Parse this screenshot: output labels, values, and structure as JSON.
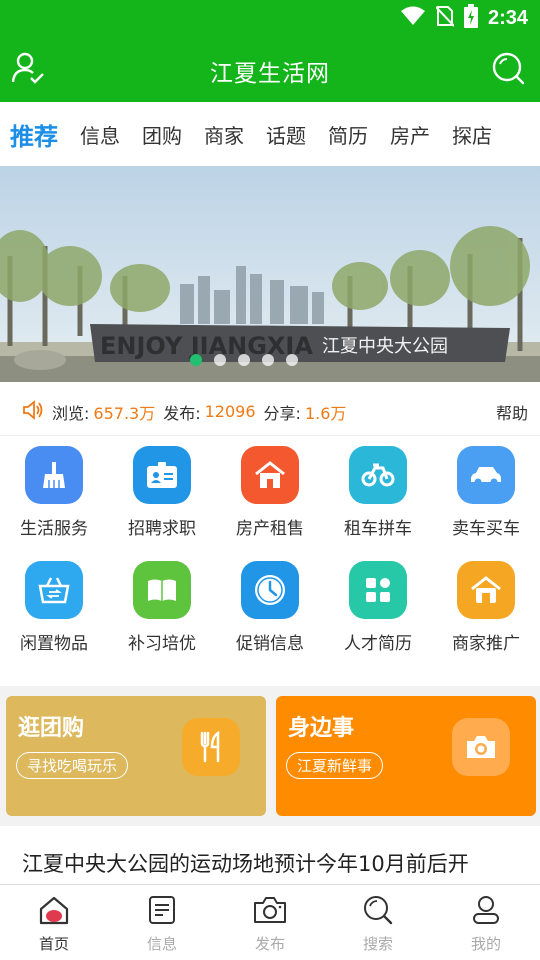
{
  "status_bar": {
    "time": "2:34"
  },
  "header": {
    "title": "江夏生活网"
  },
  "tabs": [
    {
      "label": "推荐"
    },
    {
      "label": "信息"
    },
    {
      "label": "团购"
    },
    {
      "label": "商家"
    },
    {
      "label": "话题"
    },
    {
      "label": "简历"
    },
    {
      "label": "房产"
    },
    {
      "label": "探店"
    }
  ],
  "banner": {
    "sign_text": "江夏中央大公园",
    "sign_latin": "ENJOY JIANGXIA",
    "active_slide": 1,
    "slide_count": 5
  },
  "stats": {
    "views_label": "浏览:",
    "views_value": "657.3万",
    "posts_label": "发布:",
    "posts_value": "12096",
    "shares_label": "分享:",
    "shares_value": "1.6万",
    "help": "帮助"
  },
  "services": [
    {
      "label": "生活服务",
      "icon": "broom-icon",
      "color": "#4a8df2"
    },
    {
      "label": "招聘求职",
      "icon": "id-card-icon",
      "color": "#2196e6"
    },
    {
      "label": "房产租售",
      "icon": "house-icon",
      "color": "#f3582e"
    },
    {
      "label": "租车拼车",
      "icon": "bike-icon",
      "color": "#2ab7d8"
    },
    {
      "label": "卖车买车",
      "icon": "car-icon",
      "color": "#4a9ff2"
    },
    {
      "label": "闲置物品",
      "icon": "basket-icon",
      "color": "#2ea8ee"
    },
    {
      "label": "补习培优",
      "icon": "book-icon",
      "color": "#5fc43d"
    },
    {
      "label": "促销信息",
      "icon": "clock-icon",
      "color": "#2196e6"
    },
    {
      "label": "人才简历",
      "icon": "grid-icon",
      "color": "#26c8a8"
    },
    {
      "label": "商家推广",
      "icon": "shop-icon",
      "color": "#f5a623"
    }
  ],
  "promos": [
    {
      "title": "逛团购",
      "tag": "寻找吃喝玩乐",
      "icon": "fork-knife-icon"
    },
    {
      "title": "身边事",
      "tag": "江夏新鲜事",
      "icon": "camera-icon"
    }
  ],
  "headline": "江夏中央大公园的运动场地预计今年10月前后开",
  "bottom_nav": [
    {
      "label": "首页",
      "icon": "home-icon"
    },
    {
      "label": "信息",
      "icon": "document-icon"
    },
    {
      "label": "发布",
      "icon": "camera-icon"
    },
    {
      "label": "搜索",
      "icon": "search-icon"
    },
    {
      "label": "我的",
      "icon": "user-icon"
    }
  ],
  "colors": {
    "brand": "#13b51a",
    "accent": "#1c8ee6",
    "stat_value": "#f07a15"
  }
}
